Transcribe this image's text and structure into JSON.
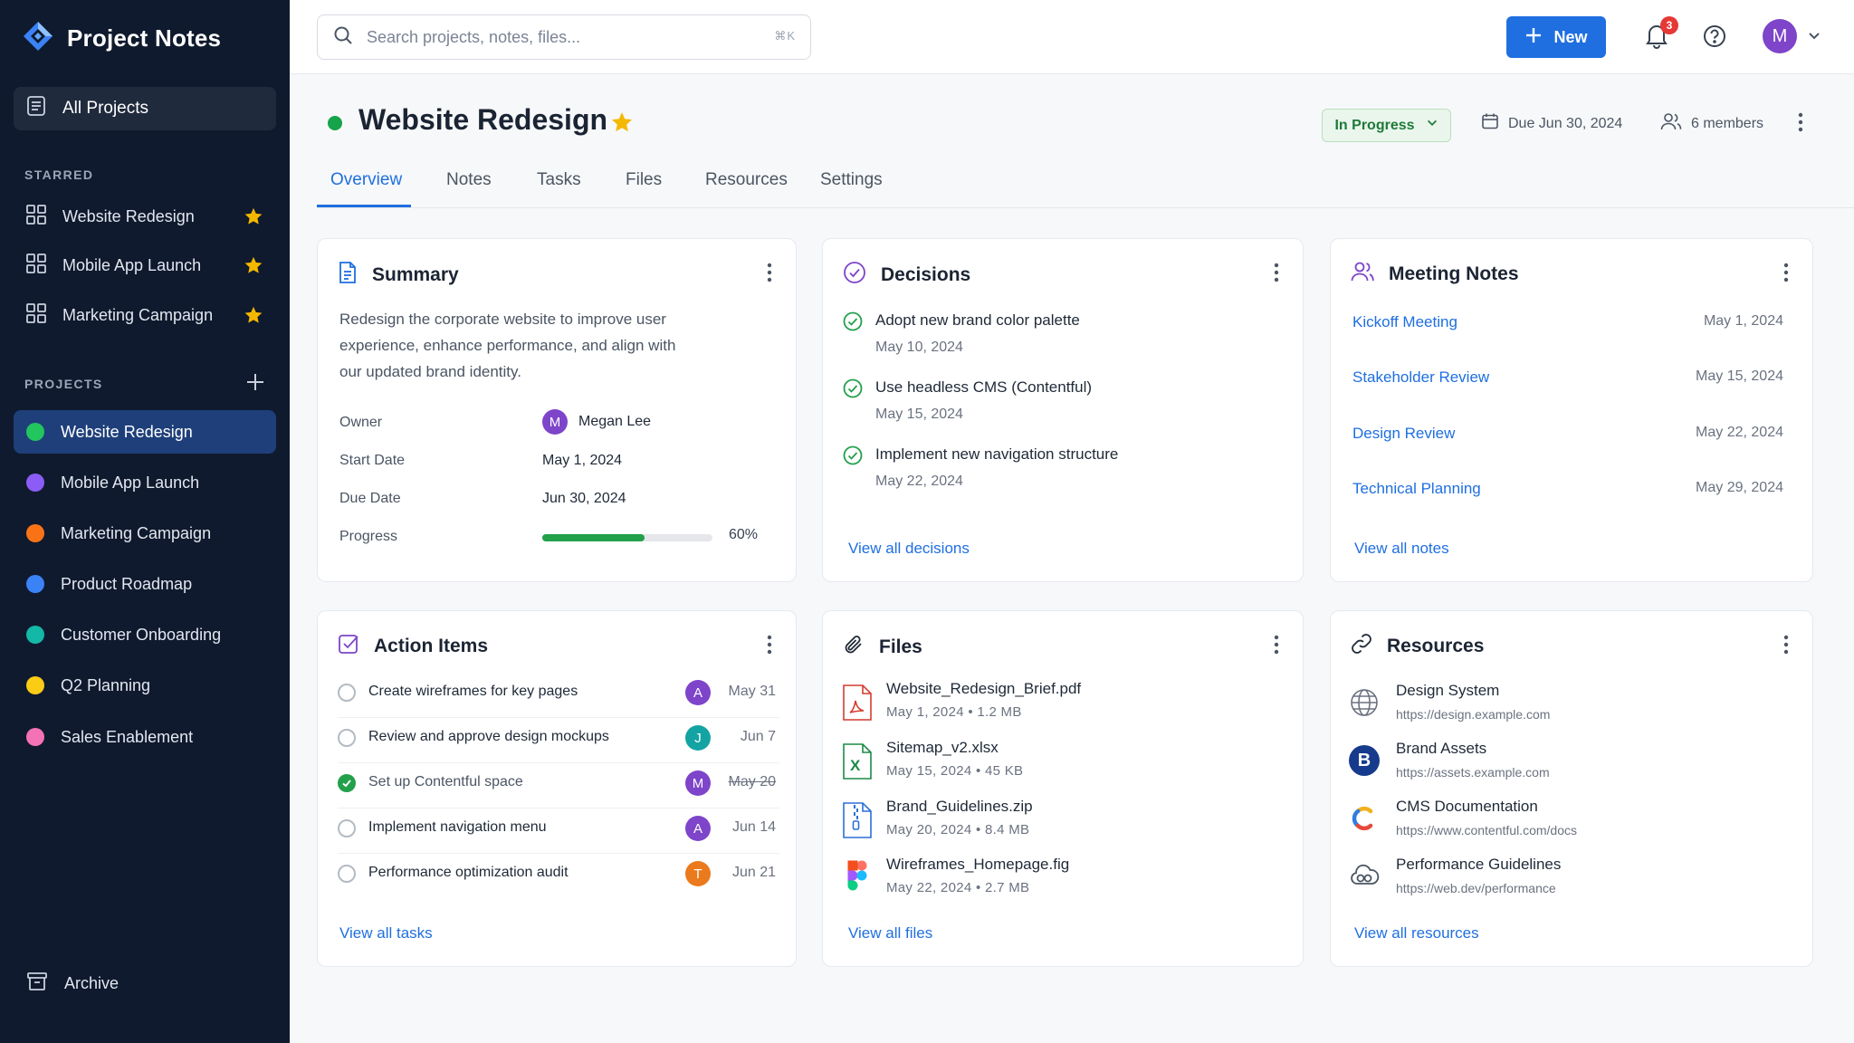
{
  "app": {
    "title": "Project Notes"
  },
  "sidebar": {
    "all_projects": "All Projects",
    "starred_label": "STARRED",
    "starred": [
      {
        "label": "Website Redesign"
      },
      {
        "label": "Mobile App Launch"
      },
      {
        "label": "Marketing Campaign"
      }
    ],
    "projects_label": "PROJECTS",
    "projects": [
      {
        "label": "Website Redesign",
        "color": "#22c55e"
      },
      {
        "label": "Mobile App Launch",
        "color": "#8b5cf6"
      },
      {
        "label": "Marketing Campaign",
        "color": "#f97316"
      },
      {
        "label": "Product Roadmap",
        "color": "#3b82f6"
      },
      {
        "label": "Customer Onboarding",
        "color": "#14b8a6"
      },
      {
        "label": "Q2 Planning",
        "color": "#facc15"
      },
      {
        "label": "Sales Enablement",
        "color": "#f472b6"
      }
    ],
    "archive": "Archive"
  },
  "topbar": {
    "search_placeholder": "Search projects, notes, files...",
    "search_shortcut": "⌘K",
    "new_button": "New",
    "notification_count": "3",
    "user_initial": "M"
  },
  "project": {
    "title": "Website Redesign",
    "status": "In Progress",
    "due": "Due Jun 30, 2024",
    "members": "6 members"
  },
  "tabs": [
    "Overview",
    "Notes",
    "Tasks",
    "Files",
    "Resources",
    "Settings"
  ],
  "summary": {
    "title": "Summary",
    "description": "Redesign the corporate website to improve user experience, enhance performance, and align with our updated brand identity.",
    "owner_label": "Owner",
    "owner_initial": "M",
    "owner": "Megan Lee",
    "start_label": "Start Date",
    "start": "May 1, 2024",
    "due_label": "Due Date",
    "due": "Jun 30, 2024",
    "progress_label": "Progress",
    "progress_text": "60%",
    "progress_fraction": 0.6
  },
  "decisions": {
    "title": "Decisions",
    "items": [
      {
        "text": "Adopt new brand color palette",
        "date": "May 10, 2024"
      },
      {
        "text": "Use headless CMS (Contentful)",
        "date": "May 15, 2024"
      },
      {
        "text": "Implement new navigation structure",
        "date": "May 22, 2024"
      }
    ],
    "view_all": "View all decisions"
  },
  "meetings": {
    "title": "Meeting Notes",
    "items": [
      {
        "name": "Kickoff Meeting",
        "date": "May 1, 2024"
      },
      {
        "name": "Stakeholder Review",
        "date": "May 15, 2024"
      },
      {
        "name": "Design Review",
        "date": "May 22, 2024"
      },
      {
        "name": "Technical Planning",
        "date": "May 29, 2024"
      }
    ],
    "view_all": "View all notes"
  },
  "actions": {
    "title": "Action Items",
    "items": [
      {
        "text": "Create wireframes for key pages",
        "assignee": "A",
        "color": "#7e44c9",
        "date": "May 31",
        "done": false
      },
      {
        "text": "Review and approve design mockups",
        "assignee": "J",
        "color": "#14a3a3",
        "date": "Jun 7",
        "done": false
      },
      {
        "text": "Set up Contentful space",
        "assignee": "M",
        "color": "#7e44c9",
        "date": "May 20",
        "done": true
      },
      {
        "text": "Implement navigation menu",
        "assignee": "A",
        "color": "#7e44c9",
        "date": "Jun 14",
        "done": false
      },
      {
        "text": "Performance optimization audit",
        "assignee": "T",
        "color": "#ea7a1c",
        "date": "Jun 21",
        "done": false
      }
    ],
    "view_all": "View all tasks"
  },
  "files": {
    "title": "Files",
    "items": [
      {
        "name": "Website_Redesign_Brief.pdf",
        "meta": "May 1, 2024  •  1.2 MB",
        "icon": "pdf-icon"
      },
      {
        "name": "Sitemap_v2.xlsx",
        "meta": "May 15, 2024  •  45 KB",
        "icon": "excel-icon"
      },
      {
        "name": "Brand_Guidelines.zip",
        "meta": "May 20, 2024  •  8.4 MB",
        "icon": "zip-icon"
      },
      {
        "name": "Wireframes_Homepage.fig",
        "meta": "May 22, 2024  •  2.7 MB",
        "icon": "figma-icon"
      }
    ],
    "view_all": "View all files"
  },
  "resources": {
    "title": "Resources",
    "items": [
      {
        "name": "Design System",
        "url": "https://design.example.com",
        "icon": "globe-icon"
      },
      {
        "name": "Brand Assets",
        "url": "https://assets.example.com",
        "icon": "brand-b-icon",
        "icon_text": "B"
      },
      {
        "name": "CMS Documentation",
        "url": "https://www.contentful.com/docs",
        "icon": "contentful-icon"
      },
      {
        "name": "Performance Guidelines",
        "url": "https://web.dev/performance",
        "icon": "cloud-icon"
      }
    ],
    "view_all": "View all resources"
  },
  "colors": {
    "accent": "#1f6fe0",
    "sidebar_bg": "#0f1a2e",
    "success": "#22a04a",
    "star": "#f5b800"
  }
}
